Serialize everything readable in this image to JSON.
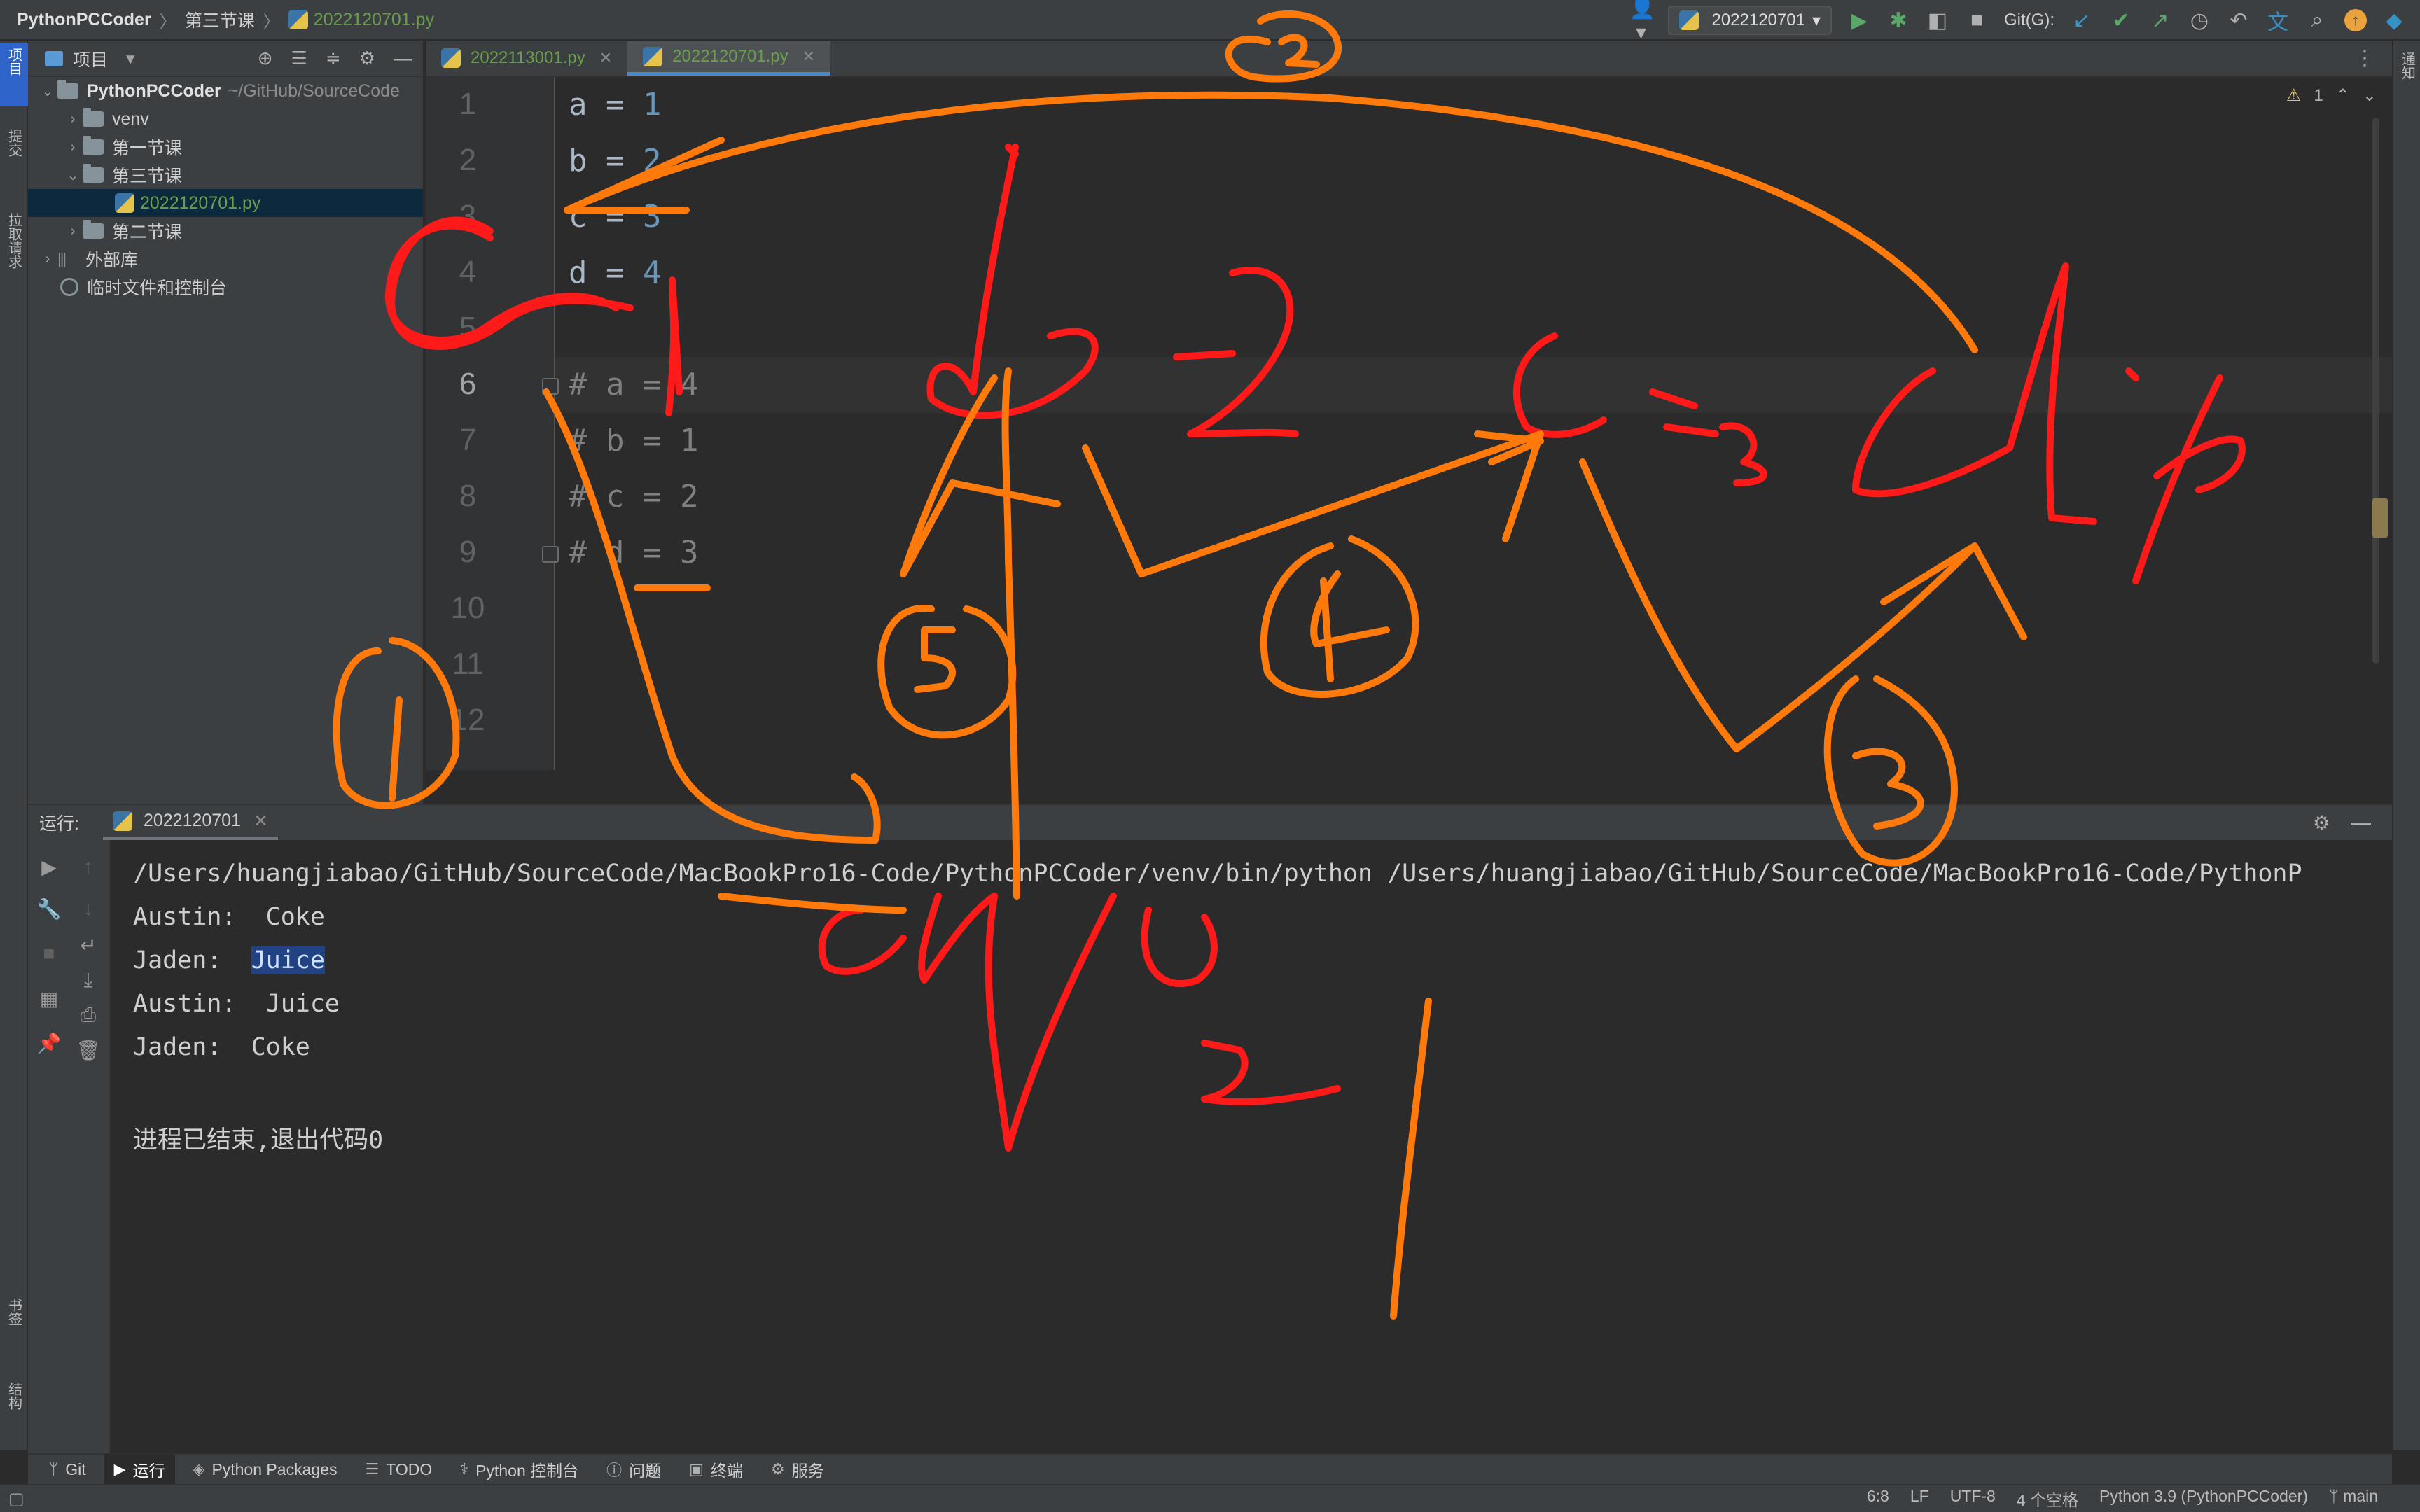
{
  "breadcrumbs": {
    "project": "PythonPCCoder",
    "folder": "第三节课",
    "file": "2022120701.py"
  },
  "toolbar": {
    "run_config": "2022120701",
    "git_label": "Git(G):",
    "user_icon": "user-icon",
    "run_icon": "play-icon",
    "debug_icon": "bug-icon",
    "stop_icon": "stop-icon",
    "search_icon": "search-icon"
  },
  "left_strip": {
    "project_tab": "项目",
    "commit_tab": "提交",
    "pull_tab": "拉取请求",
    "bookmarks_tab": "书签",
    "structure_tab": "结构"
  },
  "right_strip": {
    "notifications_tab": "通知"
  },
  "project_panel": {
    "title": "项目",
    "items": [
      {
        "label": "PythonPCCoder",
        "hint": "~/GitHub/SourceCode",
        "type": "root"
      },
      {
        "label": "venv",
        "type": "folder"
      },
      {
        "label": "第一节课",
        "type": "folder"
      },
      {
        "label": "第三节课",
        "type": "folder"
      },
      {
        "label": "2022120701.py",
        "type": "file"
      },
      {
        "label": "第二节课",
        "type": "folder"
      },
      {
        "label": "外部库",
        "type": "library"
      },
      {
        "label": "临时文件和控制台",
        "type": "scratch"
      }
    ]
  },
  "editor": {
    "tabs": [
      {
        "label": "2022113001.py",
        "active": false
      },
      {
        "label": "2022120701.py",
        "active": true
      }
    ],
    "warnings": "1",
    "line_numbers": [
      "1",
      "2",
      "3",
      "4",
      "5",
      "6",
      "7",
      "8",
      "9",
      "10",
      "11",
      "12"
    ],
    "current_line": "6",
    "lines": [
      {
        "var": "a",
        "op": " = ",
        "val": "1",
        "comment": false
      },
      {
        "var": "b",
        "op": " = ",
        "val": "2",
        "comment": false
      },
      {
        "var": "c",
        "op": " = ",
        "val": "3",
        "comment": false
      },
      {
        "var": "d",
        "op": " = ",
        "val": "4",
        "comment": false
      },
      {
        "text": "",
        "comment": false
      },
      {
        "text": "# a = 4",
        "comment": true
      },
      {
        "text": "# b = 1",
        "comment": true
      },
      {
        "text": "# c = 2",
        "comment": true
      },
      {
        "text": "# d = 3",
        "comment": true
      }
    ]
  },
  "run_panel": {
    "label": "运行:",
    "tab": "2022120701",
    "console": [
      "/Users/huangjiabao/GitHub/SourceCode/MacBookPro16-Code/PythonPCCoder/venv/bin/python /Users/huangjiabao/GitHub/SourceCode/MacBookPro16-Code/PythonP",
      "Austin:  Coke",
      "Jaden:  ",
      "Austin:  Juice",
      "Jaden:  Coke",
      "",
      "进程已结束,退出代码0"
    ],
    "selected_word": "Juice"
  },
  "bottom_tools": [
    {
      "label": "Git",
      "icon": "git-branch-icon"
    },
    {
      "label": "运行",
      "icon": "play-icon",
      "active": true
    },
    {
      "label": "Python Packages",
      "icon": "layers-icon"
    },
    {
      "label": "TODO",
      "icon": "list-icon"
    },
    {
      "label": "Python 控制台",
      "icon": "python-icon"
    },
    {
      "label": "问题",
      "icon": "info-icon"
    },
    {
      "label": "终端",
      "icon": "terminal-icon"
    },
    {
      "label": "服务",
      "icon": "services-icon"
    }
  ],
  "status_bar": {
    "position": "6:8",
    "line_sep": "LF",
    "encoding": "UTF-8",
    "indent": "4 个空格",
    "interpreter": "Python 3.9 (PythonPCCoder)",
    "branch": "main"
  },
  "colors": {
    "ink_red": "#ff1a1a",
    "ink_orange": "#ff7a0a",
    "accent_blue": "#4a88c7",
    "number_blue": "#6897bb",
    "file_green": "#6a9e4e"
  }
}
